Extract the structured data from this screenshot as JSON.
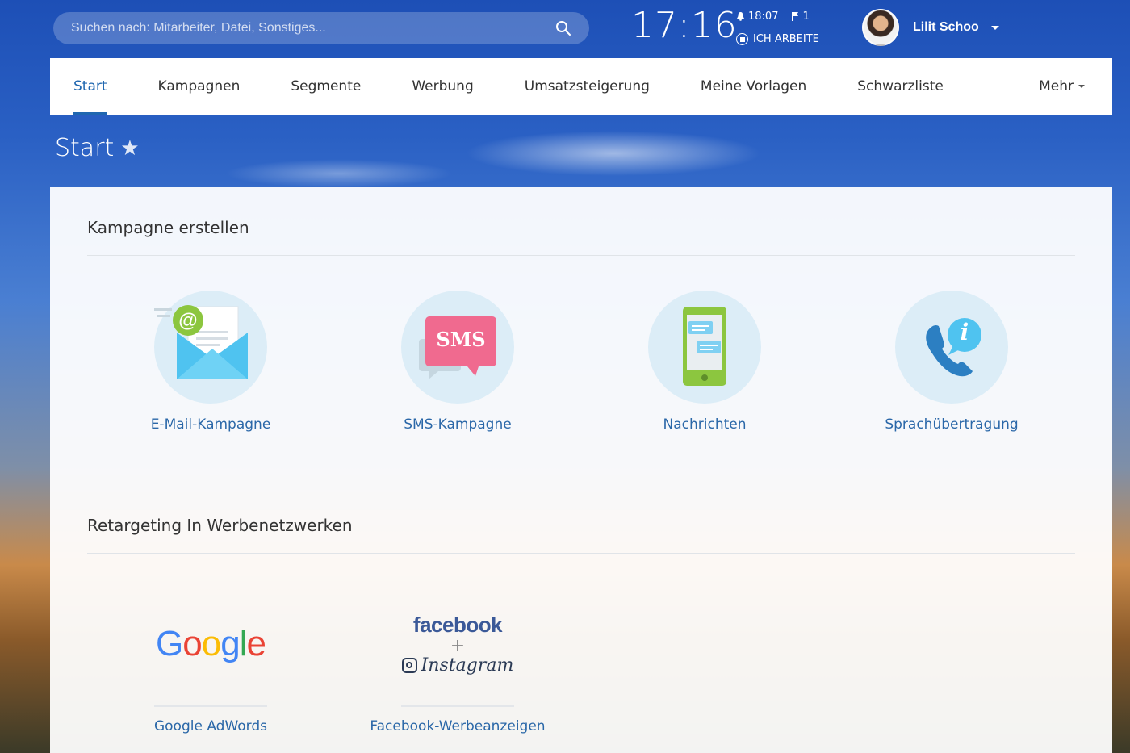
{
  "search": {
    "placeholder": "Suchen nach: Mitarbeiter, Datei, Sonstiges..."
  },
  "clock": {
    "time": "17:16",
    "alarm_time": "18:07",
    "flag_count": "1",
    "status": "ICH ARBEITE"
  },
  "user": {
    "name": "Lilit Schoo"
  },
  "nav": {
    "items": [
      {
        "label": "Start",
        "active": true
      },
      {
        "label": "Kampagnen"
      },
      {
        "label": "Segmente"
      },
      {
        "label": "Werbung"
      },
      {
        "label": "Umsatzsteigerung"
      },
      {
        "label": "Meine Vorlagen"
      },
      {
        "label": "Schwarzliste"
      }
    ],
    "more": "Mehr"
  },
  "page": {
    "title": "Start"
  },
  "campaign": {
    "title": "Kampagne erstellen",
    "tiles": [
      {
        "label": "E-Mail-Kampagne",
        "icon": "email-icon"
      },
      {
        "label": "SMS-Kampagne",
        "icon": "sms-icon",
        "badge": "SMS"
      },
      {
        "label": "Nachrichten",
        "icon": "phone-messages-icon"
      },
      {
        "label": "Sprachübertragung",
        "icon": "phone-info-icon",
        "badge": "i"
      }
    ]
  },
  "retargeting": {
    "title": "Retargeting In Werbenetzwerken",
    "tiles": [
      {
        "label": "Google AdWords",
        "logo": "Google"
      },
      {
        "label": "Facebook-Werbeanzeigen",
        "logo_top": "facebook",
        "logo_plus": "+",
        "logo_bottom": "Instagram"
      }
    ]
  },
  "colors": {
    "accent": "#2067b0",
    "link": "#2a67a8",
    "tile_bg": "#dcedf7",
    "google_blue": "#4285f4",
    "google_red": "#ea4335",
    "google_yellow": "#fbbc05",
    "google_green": "#34a853",
    "facebook": "#3b5998"
  }
}
